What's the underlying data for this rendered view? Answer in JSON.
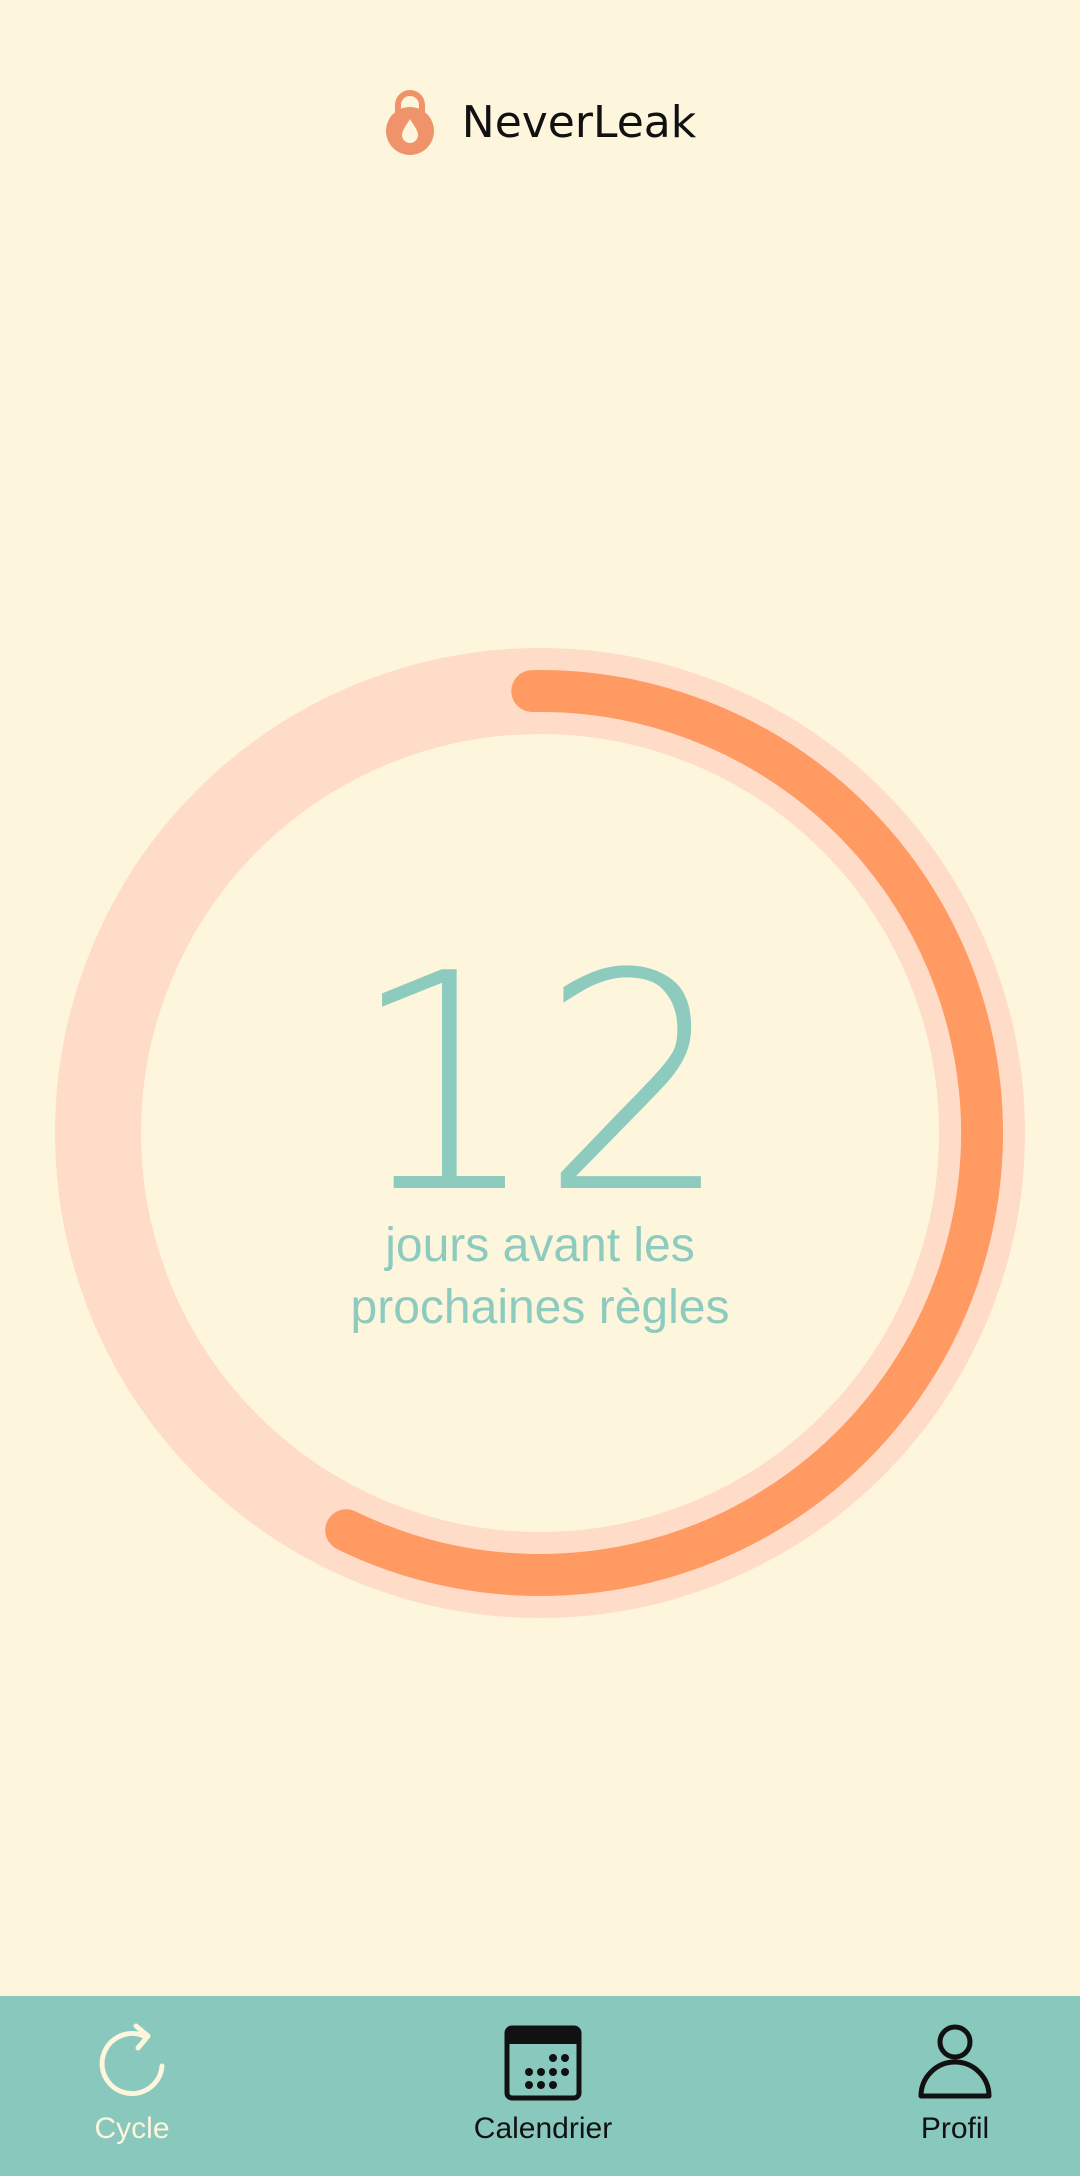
{
  "header": {
    "app_title": "NeverLeak",
    "logo_icon": "lock-drop-icon"
  },
  "cycle": {
    "days_remaining": "12",
    "caption_line1": "jours avant les",
    "caption_line2": "prochaines règles",
    "progress": 0.575
  },
  "colors": {
    "background": "#fdf6dc",
    "ring_track": "#ffdcc8",
    "ring_progress": "#ff9a62",
    "text_accent": "#8ecbbf",
    "nav_bg": "#89c8bc"
  },
  "nav": {
    "items": [
      {
        "label": "Cycle",
        "icon": "refresh-icon",
        "active": true
      },
      {
        "label": "Calendrier",
        "icon": "calendar-icon",
        "active": false
      },
      {
        "label": "Profil",
        "icon": "user-icon",
        "active": false
      }
    ]
  }
}
